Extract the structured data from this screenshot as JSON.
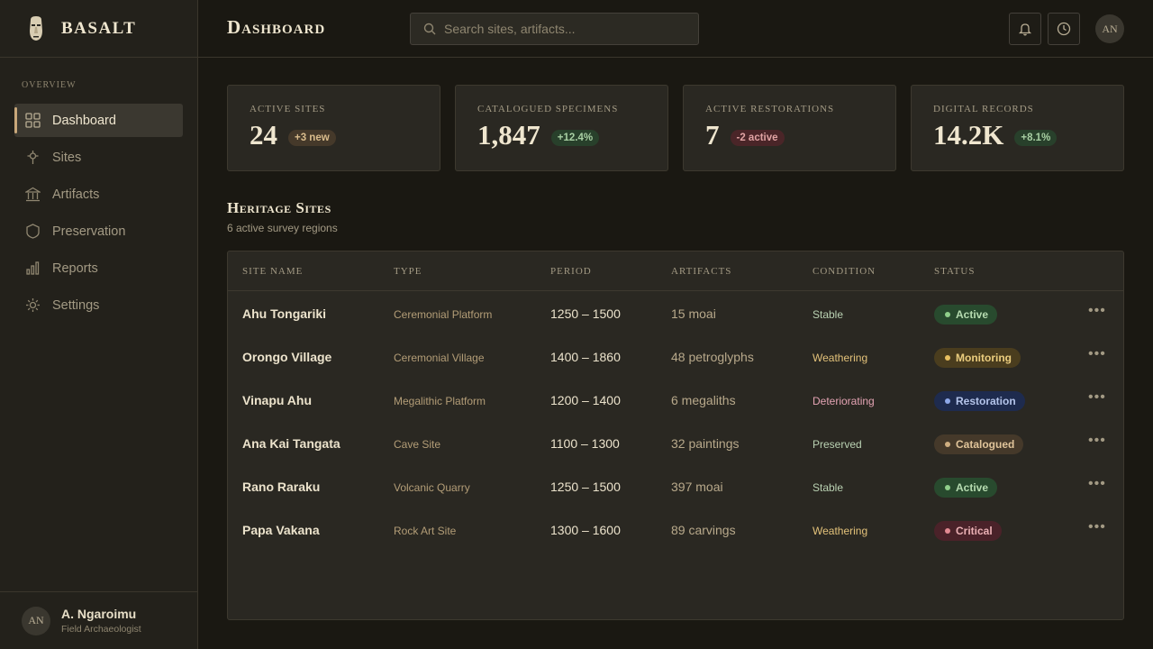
{
  "brand": {
    "name": "BASALT"
  },
  "sidebar": {
    "section_label": "OVERVIEW",
    "items": [
      {
        "label": "Dashboard",
        "icon": "grid-icon",
        "active": true
      },
      {
        "label": "Sites",
        "icon": "location-icon",
        "active": false
      },
      {
        "label": "Artifacts",
        "icon": "museum-icon",
        "active": false
      },
      {
        "label": "Preservation",
        "icon": "shield-icon",
        "active": false
      },
      {
        "label": "Reports",
        "icon": "bar-chart-icon",
        "active": false
      },
      {
        "label": "Settings",
        "icon": "gear-icon",
        "active": false
      }
    ],
    "user": {
      "initials": "AN",
      "name": "A. Ngaroimu",
      "role": "Field Archaeologist"
    }
  },
  "header": {
    "title": "Dashboard",
    "search_placeholder": "Search sites, artifacts...",
    "avatar_initials": "AN"
  },
  "stats": [
    {
      "label": "Active Sites",
      "value": "24",
      "badge": "+3 new",
      "tone": "neutral"
    },
    {
      "label": "Catalogued Specimens",
      "value": "1,847",
      "badge": "+12.4%",
      "tone": "pos"
    },
    {
      "label": "Active Restorations",
      "value": "7",
      "badge": "-2 active",
      "tone": "neg"
    },
    {
      "label": "Digital Records",
      "value": "14.2K",
      "badge": "+8.1%",
      "tone": "pos"
    }
  ],
  "section": {
    "title": "Heritage Sites",
    "subtitle": "6 active survey regions"
  },
  "table": {
    "columns": [
      "Site Name",
      "Type",
      "Period",
      "Artifacts",
      "Condition",
      "Status"
    ],
    "rows": [
      {
        "name": "Ahu Tongariki",
        "type": "Ceremonial Platform",
        "period": "1250 – 1500",
        "artifacts": "15 moai",
        "condition": "Stable",
        "status": "Active"
      },
      {
        "name": "Orongo Village",
        "type": "Ceremonial Village",
        "period": "1400 – 1860",
        "artifacts": "48 petroglyphs",
        "condition": "Weathering",
        "status": "Monitoring"
      },
      {
        "name": "Vinapu Ahu",
        "type": "Megalithic Platform",
        "period": "1200 – 1400",
        "artifacts": "6 megaliths",
        "condition": "Deteriorating",
        "status": "Restoration"
      },
      {
        "name": "Ana Kai Tangata",
        "type": "Cave Site",
        "period": "1100 – 1300",
        "artifacts": "32 paintings",
        "condition": "Preserved",
        "status": "Catalogued"
      },
      {
        "name": "Rano Raraku",
        "type": "Volcanic Quarry",
        "period": "1250 – 1500",
        "artifacts": "397 moai",
        "condition": "Stable",
        "status": "Active"
      },
      {
        "name": "Papa Vakana",
        "type": "Rock Art Site",
        "period": "1300 – 1600",
        "artifacts": "89 carvings",
        "condition": "Weathering",
        "status": "Critical"
      }
    ]
  },
  "colors": {
    "accent": "#c8a77a",
    "condition": {
      "Stable": "#b9d1b2",
      "Weathering": "#e3c27a",
      "Deteriorating": "#e3a3b3",
      "Preserved": "#b9d1b2"
    },
    "status": {
      "Active": {
        "bg": "#284a2e",
        "fg": "#b6dbb0",
        "dot": "#8fcf8a"
      },
      "Monitoring": {
        "bg": "#4a3d1e",
        "fg": "#ebcd7e",
        "dot": "#e8c060"
      },
      "Restoration": {
        "bg": "#1e2b4e",
        "fg": "#b4c4ea",
        "dot": "#8ea8e8"
      },
      "Catalogued": {
        "bg": "#45392a",
        "fg": "#e0c49a",
        "dot": "#cfae80"
      },
      "Critical": {
        "bg": "#4a2229",
        "fg": "#eab0b4",
        "dot": "#e28a92"
      }
    }
  }
}
